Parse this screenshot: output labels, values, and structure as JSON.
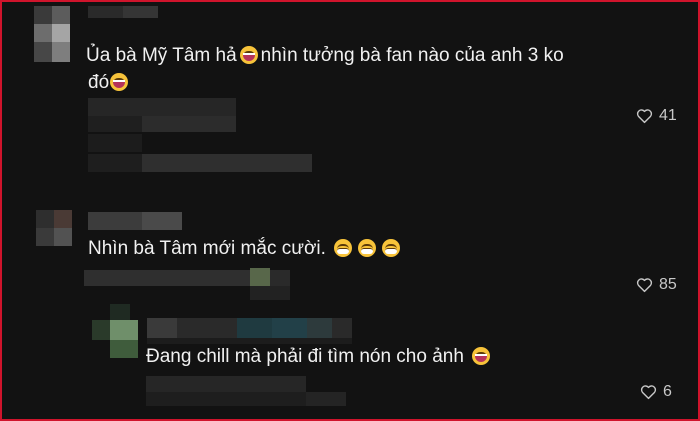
{
  "comments": [
    {
      "text_before_emoji": "Ủa bà Mỹ Tâm hả",
      "text_after_emoji": "nhìn tưởng bà fan nào của anh 3 ko",
      "line2": "đó",
      "likes": "41",
      "emoji": "laughing-face-icon"
    },
    {
      "text": "Nhìn bà Tâm mới mắc cười.",
      "likes": "85",
      "emoji": "grinning-face-icon"
    },
    {
      "text": "Đang chill mà phải đi tìm nón cho ảnh",
      "likes": "6",
      "emoji": "laughing-face-icon"
    }
  ],
  "icons": {
    "like": "heart-outline-icon"
  },
  "colors": {
    "background": "#121212",
    "text": "#f1f1f1",
    "muted": "#c8c8c8",
    "frame_border": "#d0142c"
  }
}
